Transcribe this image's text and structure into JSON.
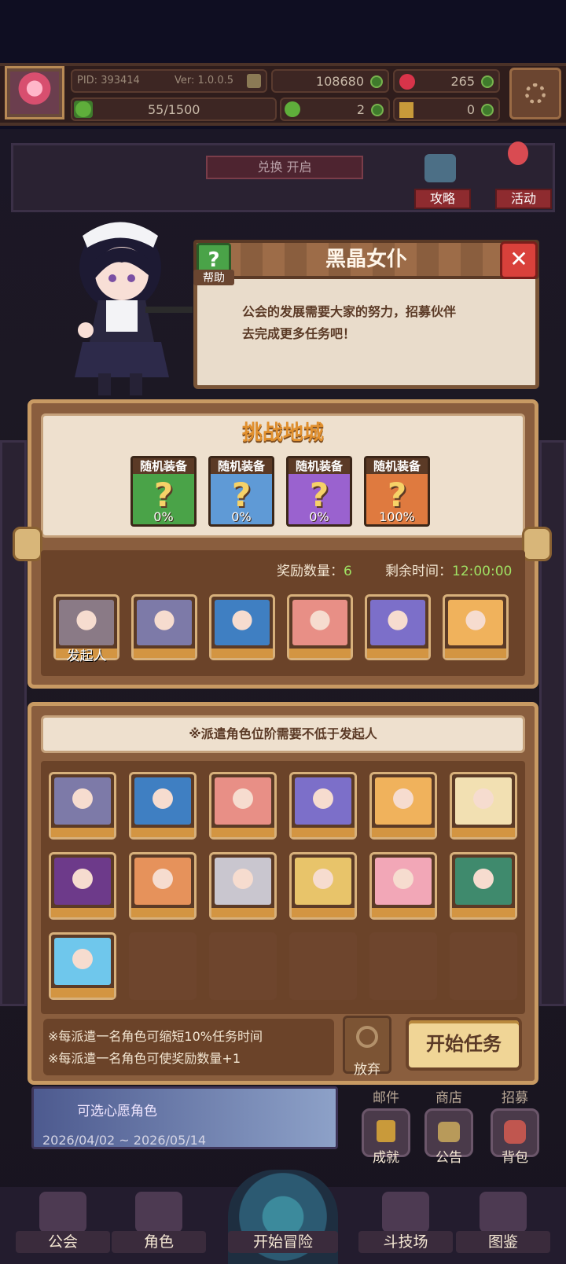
{
  "topbar": {
    "pid_label": "PID: 393414",
    "version": "Ver: 1.0.0.5",
    "gold": "108680",
    "gems": "265",
    "progress": "55/1500",
    "progress_fraction": 0.037,
    "clover": "2",
    "tickets": "0"
  },
  "scene": {
    "sign_text": "兑换 开启",
    "guide_btn": "攻略",
    "event_btn": "活动"
  },
  "dialog": {
    "title": "黑晶女仆",
    "help_label": "帮助",
    "close_symbol": "✕",
    "text_line1": "公会的发展需要大家的努力，招募伙伴",
    "text_line2": "去完成更多任务吧！"
  },
  "dungeon": {
    "title": "挑战地城",
    "rewards": [
      {
        "name": "随机装备",
        "percent": "0%",
        "color": "#4aa348"
      },
      {
        "name": "随机装备",
        "percent": "0%",
        "color": "#5f9ad6"
      },
      {
        "name": "随机装备",
        "percent": "0%",
        "color": "#9a62cf"
      },
      {
        "name": "随机装备",
        "percent": "100%",
        "color": "#df7a3f"
      }
    ],
    "reward_count_label": "奖励数量：",
    "reward_count": "6",
    "remain_label": "剩余时间：",
    "remain_time": "12:00:00",
    "initiator_label": "发起人",
    "party_colors": [
      "#8a7a86",
      "#7d7aa8",
      "#3f7fc2",
      "#e88f86",
      "#7c6fc9",
      "#f0b25c"
    ]
  },
  "dispatch": {
    "rule": "※派遣角色位阶需要不低于发起人",
    "slots": [
      {
        "filled": true,
        "color": "#7d7aa8"
      },
      {
        "filled": true,
        "color": "#3f7fc2"
      },
      {
        "filled": true,
        "color": "#e88f86"
      },
      {
        "filled": true,
        "color": "#7c6fc9"
      },
      {
        "filled": true,
        "color": "#f0b25c"
      },
      {
        "filled": true,
        "color": "#f2e0b2"
      },
      {
        "filled": true,
        "color": "#6d3a8a"
      },
      {
        "filled": true,
        "color": "#e6925b"
      },
      {
        "filled": true,
        "color": "#c9c6cf"
      },
      {
        "filled": true,
        "color": "#e8c46a"
      },
      {
        "filled": true,
        "color": "#f2a7b7"
      },
      {
        "filled": true,
        "color": "#3f8a6d"
      },
      {
        "filled": true,
        "color": "#6fc7ec"
      },
      {
        "filled": false
      },
      {
        "filled": false
      },
      {
        "filled": false
      },
      {
        "filled": false
      },
      {
        "filled": false
      }
    ],
    "tip1": "※每派遣一名角色可缩短10%任务时间",
    "tip2": "※每派遣一名角色可使奖励数量+1",
    "abandon_label": "放弃",
    "start_label": "开始任务"
  },
  "bottom": {
    "banner_caption": "可选心愿角色",
    "banner_date": "2026/04/02 ~ 2026/05/14",
    "mail": "邮件",
    "shop": "商店",
    "recruit": "招募",
    "achievement": "成就",
    "notice": "公告",
    "bag": "背包"
  },
  "nav": {
    "guild": "公会",
    "character": "角色",
    "adventure": "开始冒险",
    "arena": "斗技场",
    "codex": "图鉴"
  },
  "colors": {
    "panel": "#8a5e3e",
    "panel_border": "#c89a63",
    "accent_green": "#9fe163",
    "title_orange": "#e1902e"
  }
}
